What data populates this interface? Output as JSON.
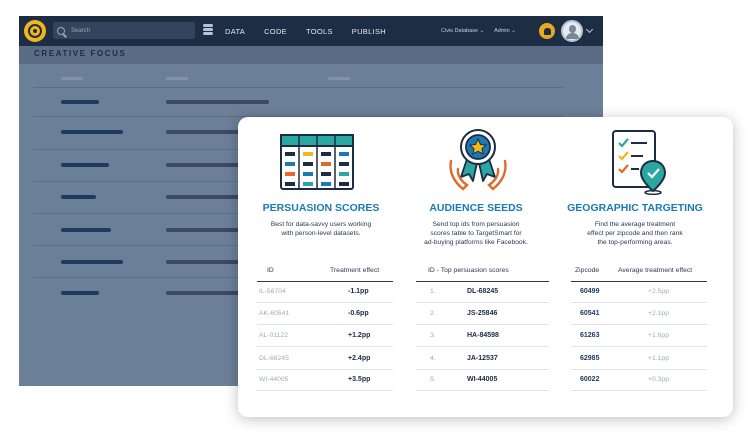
{
  "topbar": {
    "search_placeholder": "Search",
    "nav": [
      "DATA",
      "CODE",
      "TOOLS",
      "PUBLISH"
    ],
    "database_menu": "Civis Database",
    "admin_menu": "Admin"
  },
  "page": {
    "title": "CREATIVE FOCUS"
  },
  "colors": {
    "topbar": "#1d2d44",
    "background": "#6c7f99",
    "accent": "#1b7ab6",
    "orange": "#e2692b",
    "teal": "#2aa7a0",
    "yellow": "#f2b51e"
  },
  "card": {
    "persuasion": {
      "title": "PERSUASION SCORES",
      "desc1": "Best for data-savvy users working",
      "desc2": "with person-level datasets.",
      "headers": [
        "ID",
        "Treatment effect"
      ],
      "rows": [
        {
          "id": "IL-56704",
          "effect": "-1.1pp"
        },
        {
          "id": "AK-60541",
          "effect": "-0.6pp"
        },
        {
          "id": "AL-01122",
          "effect": "+1.2pp"
        },
        {
          "id": "DL-68245",
          "effect": "+2.4pp"
        },
        {
          "id": "WI-44005",
          "effect": "+3.5pp"
        }
      ]
    },
    "audience": {
      "title": "AUDIENCE SEEDS",
      "desc1": "Send top ids from persuasion",
      "desc2": "scores table to TargetSmart for",
      "desc3": "ad-buying platforms like Facebook.",
      "header": "ID - Top persuasion scores",
      "rows": [
        {
          "rank": "1.",
          "id": "DL-68245"
        },
        {
          "rank": "2.",
          "id": "JS-25846"
        },
        {
          "rank": "3.",
          "id": "HA-84598"
        },
        {
          "rank": "4.",
          "id": "JA-12537"
        },
        {
          "rank": "5.",
          "id": "WI-44005"
        }
      ]
    },
    "geo": {
      "title": "GEOGRAPHIC TARGETING",
      "desc1": "Find the average treatment",
      "desc2": "effect per zipcode and then rank",
      "desc3": "the top-performing areas.",
      "headers": [
        "Zipcode",
        "Average treatment effect"
      ],
      "rows": [
        {
          "zip": "60499",
          "effect": "+2.5pp"
        },
        {
          "zip": "60541",
          "effect": "+2.1pp"
        },
        {
          "zip": "61263",
          "effect": "+1.6pp"
        },
        {
          "zip": "62985",
          "effect": "+1.1pp"
        },
        {
          "zip": "60022",
          "effect": "+0.3pp"
        }
      ]
    }
  }
}
